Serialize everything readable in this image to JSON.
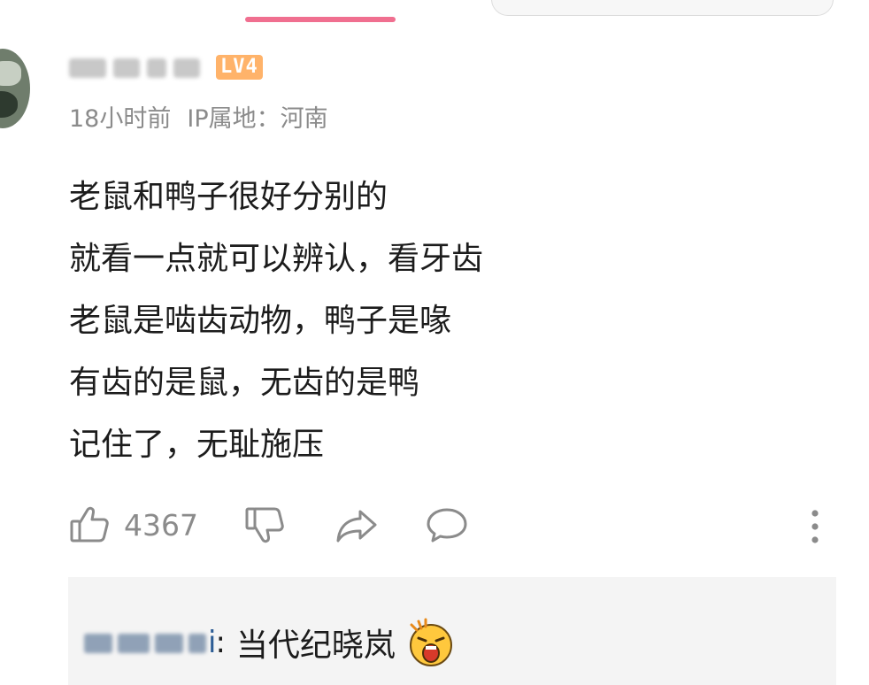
{
  "header": {
    "accent_color": "#f06f90"
  },
  "comment": {
    "username": "",
    "level_badge": "LV4",
    "time": "18小时前",
    "ip_location": "IP属地：河南",
    "lines": [
      "老鼠和鸭子很好分别的",
      "就看一点就可以辨认，看牙齿",
      "老鼠是啮齿动物，鸭子是喙",
      "有齿的是鼠，无齿的是鸭",
      "记住了，无耻施压"
    ],
    "actions": {
      "like_icon": "thumbs-up-icon",
      "like_count": "4367",
      "dislike_icon": "thumbs-down-icon",
      "share_icon": "share-arrow-icon",
      "reply_icon": "speech-bubble-icon",
      "more_icon": "more-vertical-icon"
    }
  },
  "reply": {
    "username_suffix": "i",
    "separator": ":",
    "text": "当代纪晓岚",
    "emoji": "shocked-face-emoji"
  },
  "colors": {
    "level_badge": "#ffb36a",
    "meta_text": "#8b8b8b",
    "reply_background": "#f4f4f4",
    "reply_username": "#2d5d95"
  }
}
